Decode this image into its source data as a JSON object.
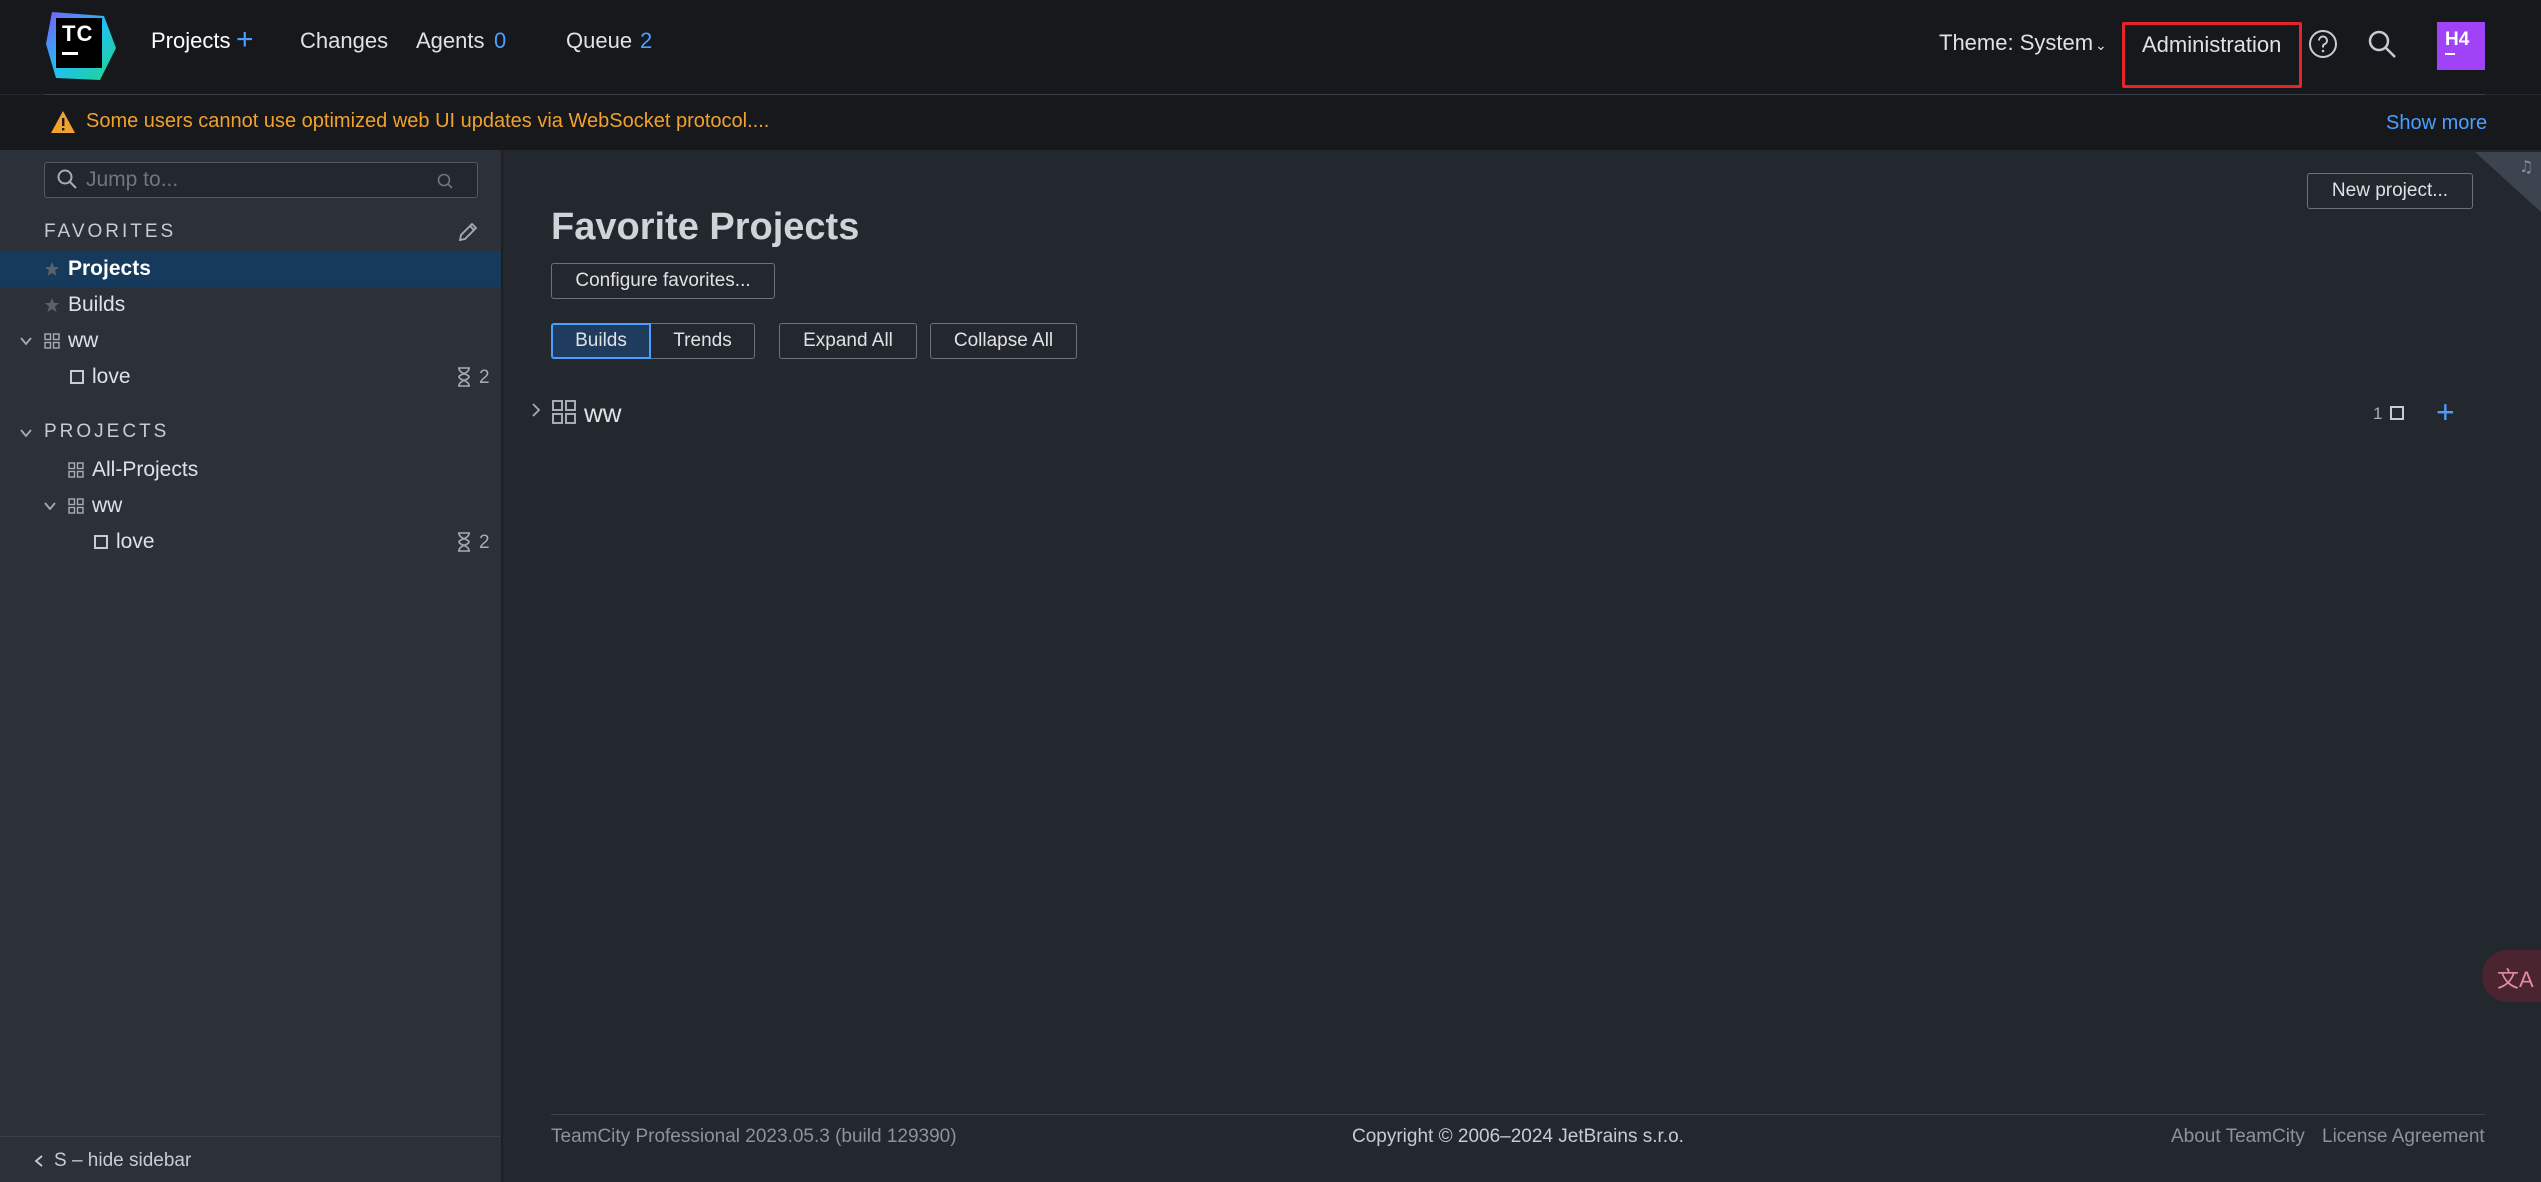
{
  "header": {
    "logo_text": "TC",
    "nav": {
      "projects": "Projects",
      "changes": "Changes",
      "agents": "Agents",
      "agents_count": "0",
      "queue": "Queue",
      "queue_count": "2"
    },
    "theme": "Theme: System",
    "administration": "Administration",
    "avatar_initials": "H4",
    "colors": {
      "accent": "#4d9fff",
      "avatar": "#a042f5",
      "highlight": "#e5252a"
    }
  },
  "banner": {
    "warning": "Some users cannot use optimized web UI updates via WebSocket protocol....",
    "show_more": "Show more",
    "color": "#f0a22d"
  },
  "sidebar": {
    "search_placeholder": "Jump to...",
    "favorites_title": "FAVORITES",
    "favorites": {
      "projects": "Projects",
      "builds": "Builds",
      "project": "ww",
      "build": "love",
      "build_queue_count": "2"
    },
    "projects_title": "PROJECTS",
    "projects": {
      "root": "All-Projects",
      "project": "ww",
      "build": "love",
      "build_queue_count": "2"
    },
    "hide_sidebar": "S – hide sidebar"
  },
  "main": {
    "title": "Favorite Projects",
    "new_project": "New project...",
    "configure_favorites": "Configure favorites...",
    "tabs": {
      "builds": "Builds",
      "trends": "Trends"
    },
    "expand_all": "Expand All",
    "collapse_all": "Collapse All",
    "project_row": {
      "name": "ww",
      "build_count": "1"
    }
  },
  "footer": {
    "version": "TeamCity Professional 2023.05.3 (build 129390)",
    "copyright": "Copyright © 2006–2024 JetBrains s.r.o.",
    "about": "About TeamCity",
    "license": "License Agreement"
  },
  "overlay": {
    "translate_label": "文A"
  }
}
